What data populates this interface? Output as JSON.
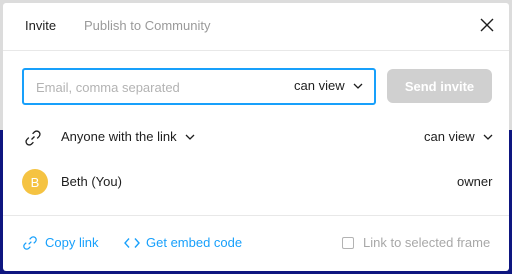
{
  "tabs": {
    "invite": "Invite",
    "publish": "Publish to Community"
  },
  "invite": {
    "placeholder": "Email, comma separated",
    "value": "",
    "permission": "can view",
    "send_label": "Send invite"
  },
  "link_access": {
    "scope": "Anyone with the link",
    "permission": "can view"
  },
  "members": [
    {
      "initial": "B",
      "name": "Beth (You)",
      "role": "owner"
    }
  ],
  "footer": {
    "copy_link": "Copy link",
    "embed_code": "Get embed code",
    "link_to_frame": "Link to selected frame",
    "link_to_frame_checked": false
  },
  "colors": {
    "accent": "#18a0fb",
    "avatar": "#f5c342",
    "send_disabled": "#d0d0d0",
    "backdrop_navy": "#0e1680"
  },
  "icons": {
    "close": "close-icon",
    "chevron": "chevron-down-icon",
    "link": "link-icon",
    "code": "code-icon"
  }
}
